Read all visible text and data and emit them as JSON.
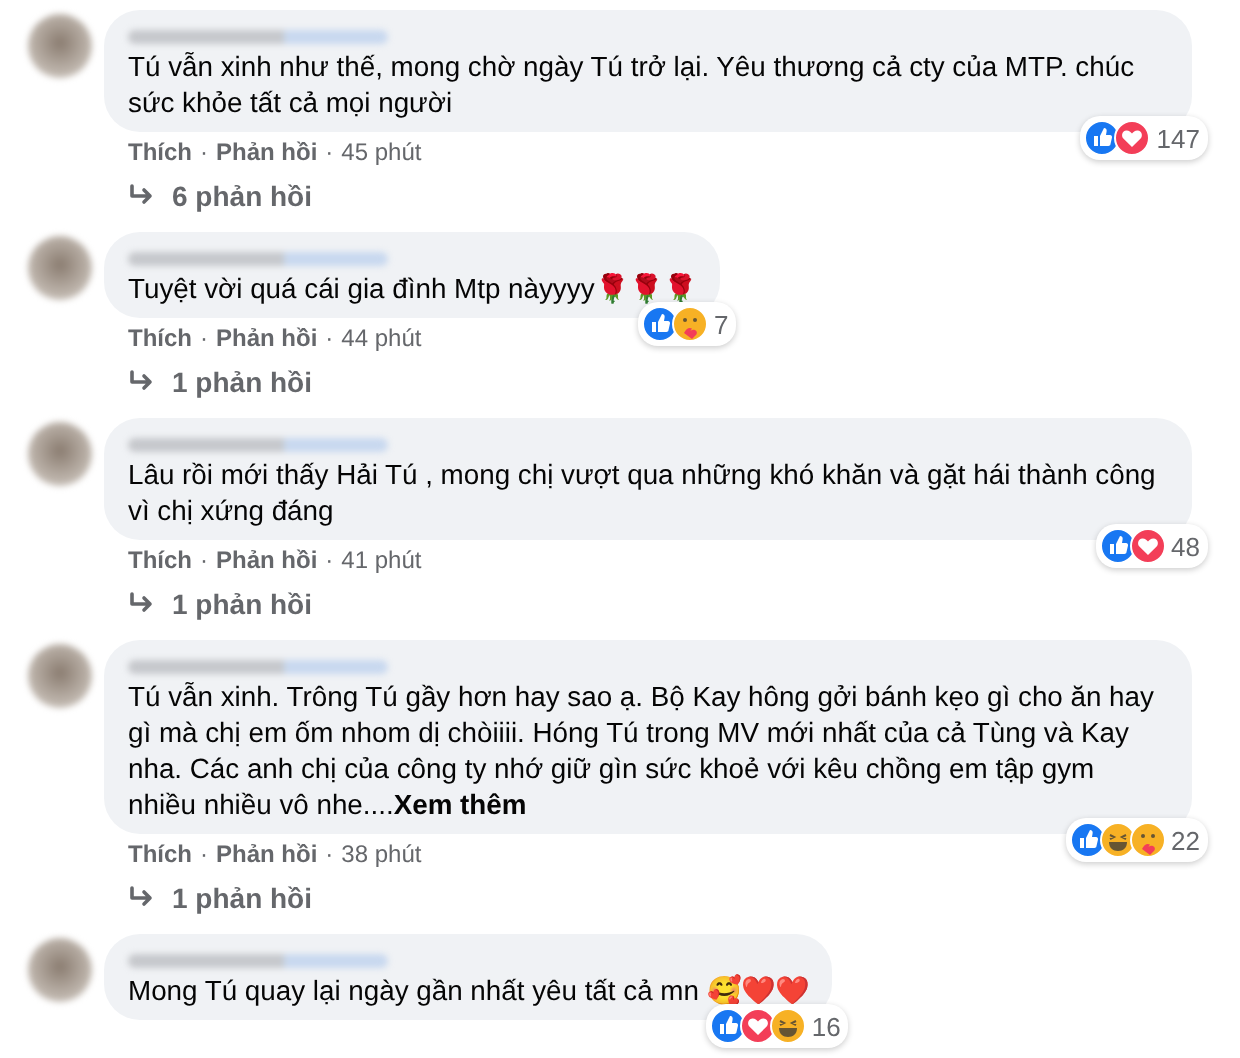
{
  "comments": [
    {
      "text": "Tú vẫn xinh như thế, mong chờ ngày Tú trở lại. Yêu thương cả cty của MTP. chúc sức khỏe tất cả mọi người",
      "reactions": [
        {
          "kind": "like"
        },
        {
          "kind": "love"
        }
      ],
      "reaction_count": "147",
      "footer": [
        {
          "kind": "link",
          "text": "Thích"
        },
        {
          "kind": "dot",
          "text": "·"
        },
        {
          "kind": "link",
          "text": "Phản hồi"
        },
        {
          "kind": "dot",
          "text": "·"
        },
        {
          "kind": "time",
          "text": "45 phút"
        }
      ],
      "replies": "6 phản hồi"
    },
    {
      "text": "Tuyệt vời quá cái gia đình Mtp nàyyyy🌹🌹🌹",
      "reactions": [
        {
          "kind": "like"
        },
        {
          "kind": "care"
        }
      ],
      "reaction_count": "7",
      "footer": [
        {
          "kind": "link",
          "text": "Thích"
        },
        {
          "kind": "dot",
          "text": "·"
        },
        {
          "kind": "link",
          "text": "Phản hồi"
        },
        {
          "kind": "dot",
          "text": "·"
        },
        {
          "kind": "time",
          "text": "44 phút"
        }
      ],
      "replies": "1 phản hồi"
    },
    {
      "text": "Lâu rồi mới thấy Hải Tú , mong chị vượt qua những khó khăn và gặt hái thành công vì chị xứng đáng",
      "reactions": [
        {
          "kind": "like"
        },
        {
          "kind": "love"
        }
      ],
      "reaction_count": "48",
      "footer": [
        {
          "kind": "link",
          "text": "Thích"
        },
        {
          "kind": "dot",
          "text": "·"
        },
        {
          "kind": "link",
          "text": "Phản hồi"
        },
        {
          "kind": "dot",
          "text": "·"
        },
        {
          "kind": "time",
          "text": "41 phút"
        }
      ],
      "replies": "1 phản hồi"
    },
    {
      "text": "Tú vẫn xinh. Trông Tú gầy hơn hay sao ạ. Bộ Kay hông gởi bánh kẹo gì cho ăn hay gì mà chị em ốm nhom dị chòiiii. Hóng Tú trong MV mới nhất của cả Tùng và Kay nha. Các anh chị của công ty nhớ giữ gìn sức khoẻ với kêu chồng em tập gym nhiều nhiều vô nhe....",
      "more_link": "Xem thêm",
      "reactions": [
        {
          "kind": "like"
        },
        {
          "kind": "haha"
        },
        {
          "kind": "care"
        }
      ],
      "reaction_count": "22",
      "footer": [
        {
          "kind": "link",
          "text": "Thích"
        },
        {
          "kind": "dot",
          "text": "·"
        },
        {
          "kind": "link",
          "text": "Phản hồi"
        },
        {
          "kind": "dot",
          "text": "·"
        },
        {
          "kind": "time",
          "text": "38 phút"
        }
      ],
      "replies": "1 phản hồi"
    },
    {
      "text": "Mong Tú quay lại ngày gần nhất yêu tất cả mn 🥰❤️❤️",
      "reactions": [
        {
          "kind": "like"
        },
        {
          "kind": "love"
        },
        {
          "kind": "haha"
        }
      ],
      "reaction_count": "16"
    }
  ]
}
